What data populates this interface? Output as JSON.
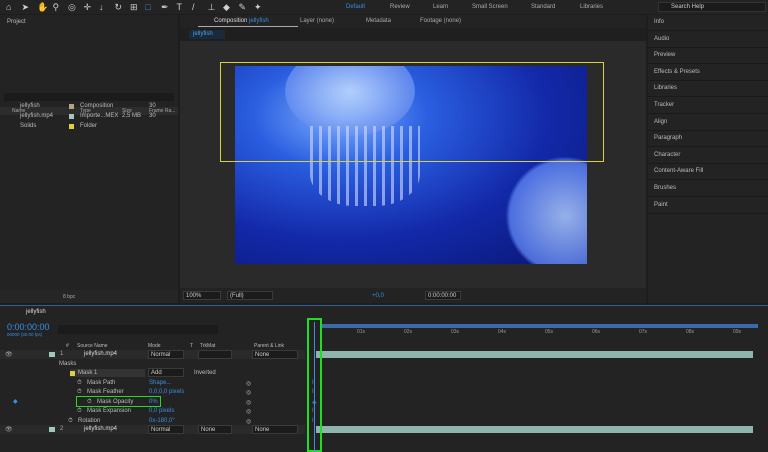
{
  "toolbar": {
    "tools": [
      "home-icon",
      "selection-icon",
      "hand-icon",
      "zoom-icon",
      "orbit-icon",
      "pan-icon",
      "dolly-icon",
      "rotate-icon",
      "anchor-icon",
      "rectangle-icon",
      "pen-icon",
      "text-icon",
      "brush-icon",
      "clone-stamp-icon",
      "eraser-icon",
      "roto-brush-icon",
      "puppet-icon"
    ],
    "workspaces": [
      "Default",
      "Review",
      "Learn",
      "Small Screen",
      "Standard",
      "Libraries"
    ],
    "active_workspace": "Default",
    "search_placeholder": "Search Help"
  },
  "project": {
    "title": "Project",
    "columns": [
      "Name",
      "Type",
      "Size",
      "Frame Ra..."
    ],
    "items": [
      {
        "name": "jellyfish",
        "type": "Composition",
        "size": "",
        "fps": "30",
        "label": "#b9a37d"
      },
      {
        "name": "jellyfish.mp4",
        "type": "Importe...MEX",
        "size": "2,5 MB",
        "fps": "30",
        "label": "#9ec9c3"
      },
      {
        "name": "Solids",
        "type": "Folder",
        "size": "",
        "fps": "",
        "label": "#e2d03a"
      }
    ],
    "bpc": "8 bpc"
  },
  "viewer": {
    "tab": "Composition",
    "comp_name": "jellyfish",
    "other_tabs": [
      "Layer (none)",
      "Metadata",
      "Footage (none)"
    ],
    "breadcrumb": "jellyfish",
    "zoom": "100%",
    "resolution": "(Full)",
    "exposure": "+0,0",
    "timecode": "0:00:00:00"
  },
  "right_panels": [
    "Info",
    "Audio",
    "Preview",
    "Effects & Presets",
    "Libraries",
    "Tracker",
    "Align",
    "Paragraph",
    "Character",
    "Content-Aware Fill",
    "Brushes",
    "Paint"
  ],
  "timeline": {
    "comp_tab": "jellyfish",
    "timecode": "0:00:00:00",
    "frame_info": "00000 (30.00 fps)",
    "columns": [
      "#",
      "Source Name",
      "Mode",
      "T",
      "TrkMat",
      "Parent & Link"
    ],
    "ruler": [
      "01s",
      "02s",
      "03s",
      "04s",
      "05s",
      "06s",
      "07s",
      "08s",
      "09s"
    ],
    "layers": [
      {
        "num": "1",
        "name": "jellyfish.mp4",
        "mode": "Normal",
        "trkmat": "",
        "parent": "None"
      },
      {
        "num": "2",
        "name": "jellyfish.mp4",
        "mode": "Normal",
        "trkmat": "None",
        "parent": "None"
      }
    ],
    "masks_label": "Masks",
    "mask": {
      "name": "Mask 1",
      "mode": "Add",
      "inverted": "Inverted"
    },
    "props": [
      {
        "name": "Mask Path",
        "value": "Shape..."
      },
      {
        "name": "Mask Feather",
        "value": "0,0,0,0 pixels"
      },
      {
        "name": "Mask Opacity",
        "value": "0%"
      },
      {
        "name": "Mask Expansion",
        "value": "0,0 pixels"
      },
      {
        "name": "Rotation",
        "value": "0x-180,0°"
      }
    ]
  },
  "colors": {
    "accent": "#3a8fe0",
    "highlight": "#22dd22",
    "mask": "#d8d040",
    "track": "#8fb4ad"
  }
}
